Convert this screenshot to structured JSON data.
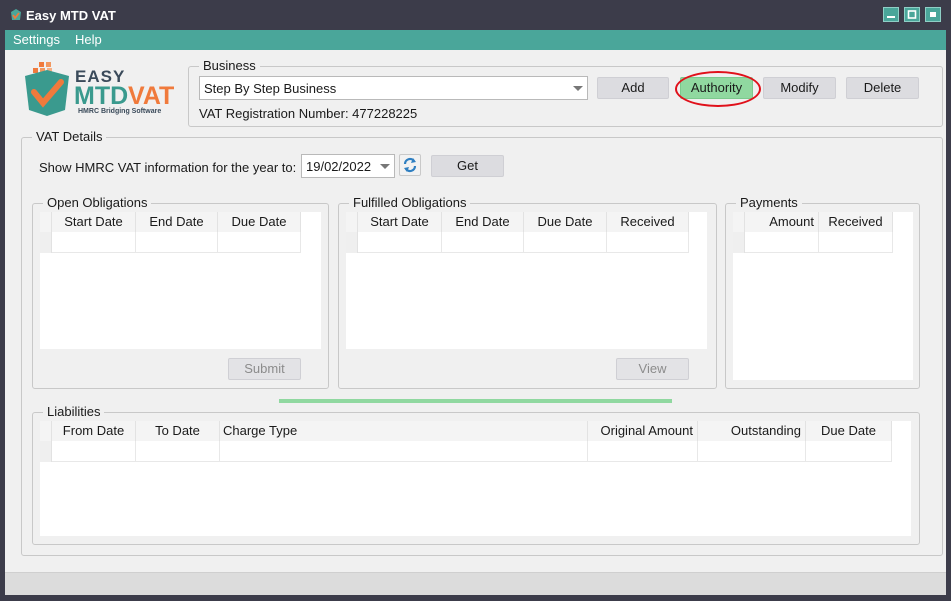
{
  "window": {
    "title": "Easy MTD VAT",
    "controls": [
      "minimize-icon",
      "restore-icon",
      "close-icon"
    ]
  },
  "menu": {
    "items": [
      "Settings",
      "Help"
    ]
  },
  "logo": {
    "line1": "EASY",
    "line2_a": "MTD",
    "line2_b": "VAT",
    "tagline": "HMRC Bridging Software"
  },
  "business": {
    "legend": "Business",
    "selected": "Step By Step Business",
    "vat_reg_label": "VAT Registration Number: 477228225",
    "buttons": {
      "add": "Add",
      "authority": "Authority",
      "modify": "Modify",
      "delete": "Delete"
    }
  },
  "vat_details": {
    "legend": "VAT Details",
    "show_label": "Show HMRC VAT information for the year to:",
    "date_value": "19/02/2022",
    "get_label": "Get"
  },
  "open_obligations": {
    "legend": "Open Obligations",
    "columns": [
      "Start Date",
      "End Date",
      "Due Date"
    ],
    "submit_label": "Submit"
  },
  "fulfilled_obligations": {
    "legend": "Fulfilled Obligations",
    "columns": [
      "Start Date",
      "End Date",
      "Due Date",
      "Received"
    ],
    "view_label": "View"
  },
  "payments": {
    "legend": "Payments",
    "columns": [
      "Amount",
      "Received"
    ]
  },
  "liabilities": {
    "legend": "Liabilities",
    "columns": [
      "From Date",
      "To Date",
      "Charge Type",
      "Original Amount",
      "Outstanding",
      "Due Date"
    ]
  },
  "progress": {
    "fraction": 1.0
  },
  "colors": {
    "accent": "#4aa69a",
    "titlebar": "#3c3c4a",
    "authority_button": "#90d8a0",
    "highlight_ring": "#e0101a"
  }
}
